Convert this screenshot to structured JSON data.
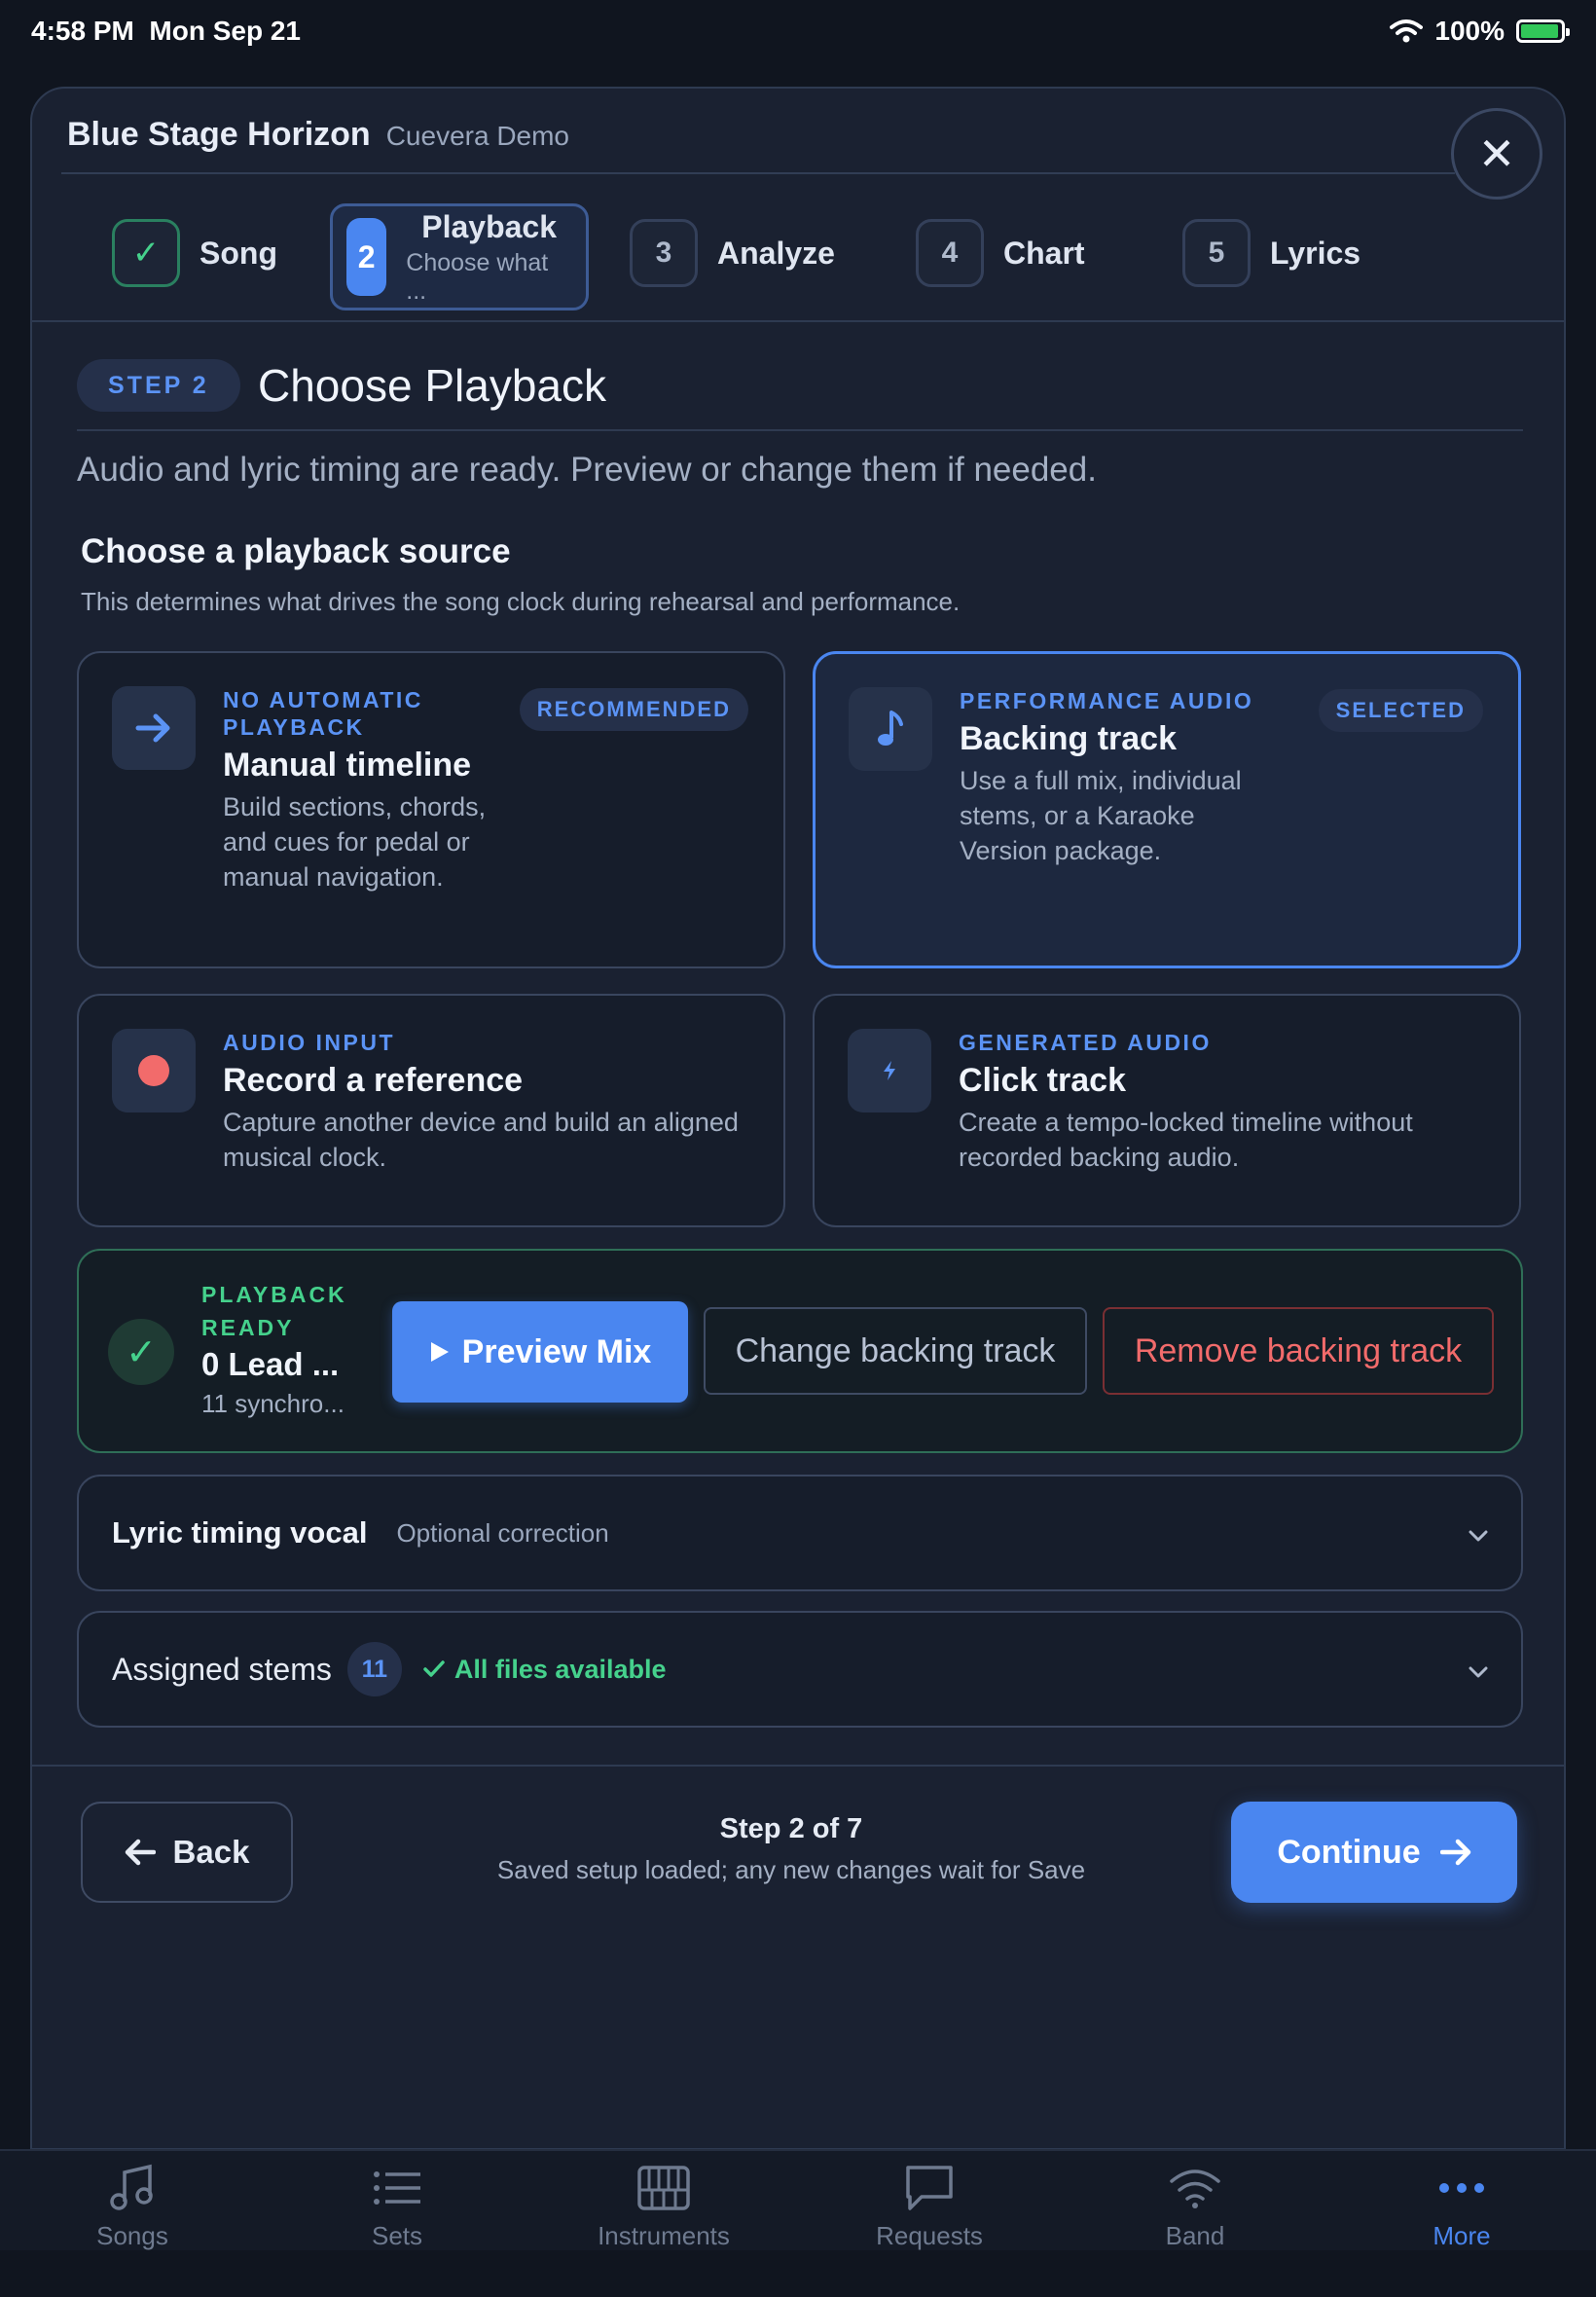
{
  "status": {
    "time": "4:58 PM",
    "date": "Mon Sep 21",
    "battery": "100%"
  },
  "header": {
    "title": "Blue Stage Horizon",
    "subtitle": "Cuevera Demo",
    "close_icon": "close-icon"
  },
  "steps": [
    {
      "num": "✓",
      "label": "Song"
    },
    {
      "num": "2",
      "label": "Playback",
      "sub": "Choose what ..."
    },
    {
      "num": "3",
      "label": "Analyze"
    },
    {
      "num": "4",
      "label": "Chart"
    },
    {
      "num": "5",
      "label": "Lyrics"
    }
  ],
  "page": {
    "step_pill": "STEP 2",
    "title": "Choose Playback",
    "intro": "Audio and lyric timing are ready. Preview or change them if needed.",
    "section_head": "Choose a playback source",
    "section_desc": "This determines what drives the song clock during rehearsal and performance."
  },
  "cards": [
    {
      "eyebrow": "NO AUTOMATIC PLAYBACK",
      "title": "Manual timeline",
      "desc": "Build sections, chords, and cues for pedal or manual navigation.",
      "badge": "RECOMMENDED",
      "icon": "arrow-right-icon"
    },
    {
      "eyebrow": "PERFORMANCE AUDIO",
      "title": "Backing track",
      "desc": "Use a full mix, individual stems, or a Karaoke Version package.",
      "badge": "SELECTED",
      "icon": "music-note-icon"
    },
    {
      "eyebrow": "AUDIO INPUT",
      "title": "Record a reference",
      "desc": "Capture another device and build an aligned musical clock.",
      "icon": "record-dot-icon"
    },
    {
      "eyebrow": "GENERATED AUDIO",
      "title": "Click track",
      "desc": "Create a tempo-locked timeline without recorded backing audio.",
      "icon": "bolt-icon"
    }
  ],
  "ready": {
    "eyebrow": "PLAYBACK READY",
    "title": "0 Lead ...",
    "sub": "11 synchro...",
    "preview_label": "Preview Mix",
    "change_label": "Change backing track",
    "remove_label": "Remove backing track"
  },
  "accordions": {
    "lyric_title": "Lyric timing vocal",
    "lyric_note": "Optional correction",
    "stems_title": "Assigned stems",
    "stems_count": "11",
    "stems_ok": "All files available"
  },
  "footer": {
    "back_label": "Back",
    "step_text": "Step 2 of 7",
    "note": "Saved setup loaded; any new changes wait for Save",
    "continue_label": "Continue"
  },
  "tabs": [
    {
      "label": "Songs",
      "icon": "music-notes-icon"
    },
    {
      "label": "Sets",
      "icon": "list-icon"
    },
    {
      "label": "Instruments",
      "icon": "piano-icon"
    },
    {
      "label": "Requests",
      "icon": "chat-bubble-icon"
    },
    {
      "label": "Band",
      "icon": "wifi-icon"
    },
    {
      "label": "More",
      "icon": "more-dots-icon",
      "active": true
    }
  ],
  "colors": {
    "accent": "#4a86f0",
    "success": "#45d18c",
    "danger": "#f26b6b",
    "background": "#10151f",
    "panel": "#1a2131"
  }
}
